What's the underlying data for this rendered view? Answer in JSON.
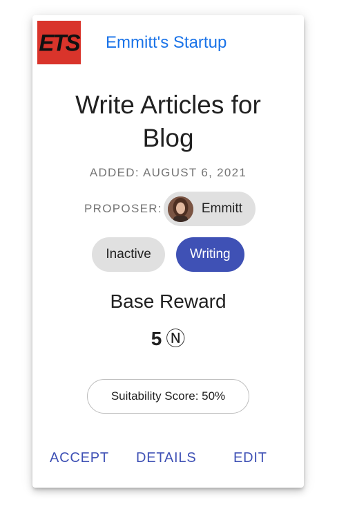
{
  "header": {
    "logo_text": "ETS",
    "company_name": "Emmitt's Startup"
  },
  "task": {
    "title_line1": "Write Articles for",
    "title_line2": "Blog",
    "added": "ADDED: AUGUST 6, 2021",
    "proposer_label": "PROPOSER:",
    "proposer_name": "Emmitt"
  },
  "status": {
    "state": "Inactive",
    "category": "Writing"
  },
  "reward": {
    "label": "Base Reward",
    "amount": "5",
    "unit_symbol": "Ⓝ"
  },
  "suitability": {
    "text": "Suitability Score: 50%"
  },
  "actions": {
    "accept": "ACCEPT",
    "details": "DETAILS",
    "edit": "EDIT"
  },
  "colors": {
    "accent": "#3f51b5",
    "link": "#1a73e8",
    "logo_bg": "#d9342b",
    "chip_grey": "#e0e0e0"
  }
}
